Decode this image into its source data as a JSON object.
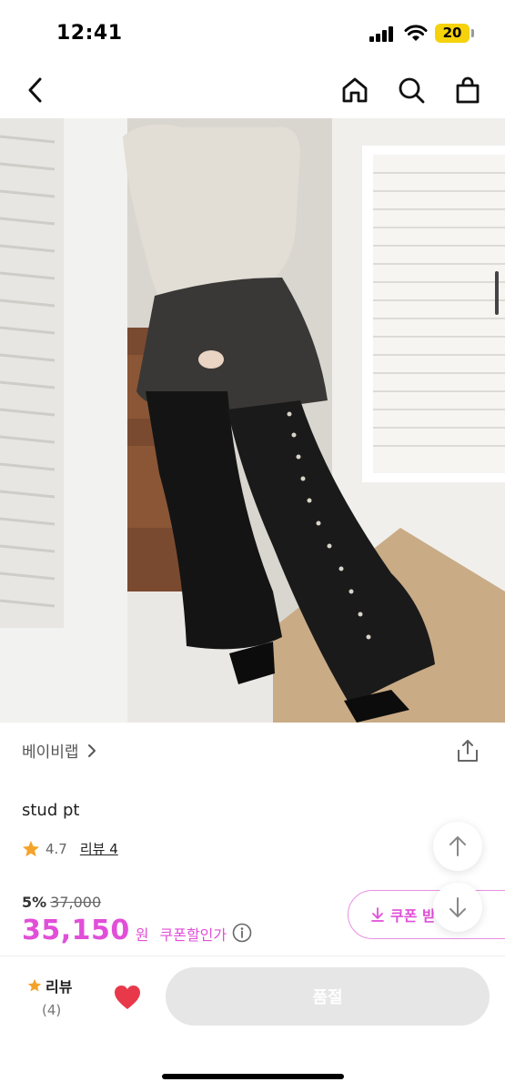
{
  "status_bar": {
    "time": "12:41",
    "battery": "20",
    "battery_color": "#f5d20c"
  },
  "nav": {
    "back_icon": "chevron-left-icon",
    "home_icon": "home-icon",
    "search_icon": "search-icon",
    "cart_icon": "shopping-bag-icon"
  },
  "product": {
    "brand": "베이비랩",
    "name": "stud pt",
    "rating": "4.7",
    "review_link": "리뷰 4",
    "discount": "5%",
    "original_price": "37,000",
    "price": "35,150",
    "currency": "원",
    "coupon_price_label": "쿠폰할인가",
    "coupon_button": "쿠폰 받"
  },
  "bottom_bar": {
    "review_label": "리뷰",
    "review_count": "(4)",
    "soldout_label": "품절"
  },
  "colors": {
    "accent": "#e14fd8",
    "star": "#f4a32a",
    "heart": "#e8394a"
  }
}
